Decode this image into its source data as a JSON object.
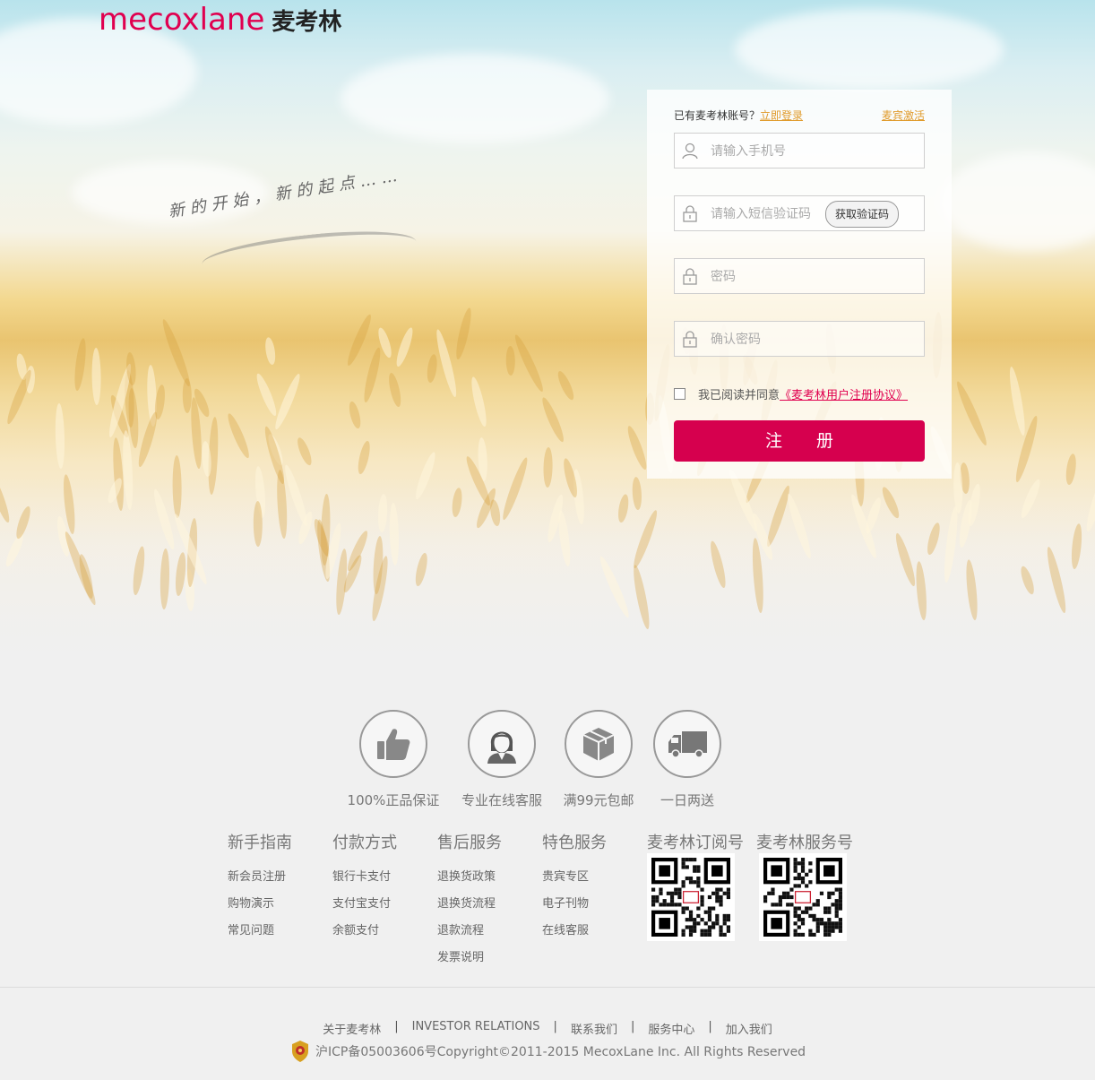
{
  "brand": {
    "logo_en": "mecoxlane",
    "logo_cn": "麦考林",
    "brand_color": "#e0004f"
  },
  "hero": {
    "slogan": "新的开始，新的起点……"
  },
  "register": {
    "has_account": "已有麦考林账号？",
    "login_link": "立即登录",
    "activate_link": "麦宾激活",
    "phone_placeholder": "请输入手机号",
    "sms_placeholder": "请输入短信验证码",
    "sms_button": "获取验证码",
    "password_placeholder": "密码",
    "confirm_placeholder": "确认密码",
    "agree_text": "我已阅读并同意",
    "agreement_link": "《麦考林用户注册协议》",
    "submit_label": "注册",
    "submit_color": "#d6004e"
  },
  "features": [
    {
      "icon": "thumbs-up-icon",
      "label": "100%正品保证"
    },
    {
      "icon": "customer-service-icon",
      "label": "专业在线客服"
    },
    {
      "icon": "package-icon",
      "label": "满99元包邮"
    },
    {
      "icon": "truck-icon",
      "label": "一日两送"
    }
  ],
  "columns": [
    {
      "title": "新手指南",
      "items": [
        "新会员注册",
        "购物演示",
        "常见问题"
      ]
    },
    {
      "title": "付款方式",
      "items": [
        "银行卡支付",
        "支付宝支付",
        "余额支付"
      ]
    },
    {
      "title": "售后服务",
      "items": [
        "退换货政策",
        "退换货流程",
        "退款流程",
        "发票说明"
      ]
    },
    {
      "title": "特色服务",
      "items": [
        "贵宾专区",
        "电子刊物",
        "在线客服"
      ]
    }
  ],
  "qr": [
    {
      "title": "麦考林订阅号",
      "icon": "qr-code-icon"
    },
    {
      "title": "麦考林服务号",
      "icon": "qr-code-icon"
    }
  ],
  "footer": {
    "links": [
      "关于麦考林",
      "INVESTOR RELATIONS",
      "联系我们",
      "服务中心",
      "加入我们"
    ],
    "separator": "|",
    "copyright": "沪ICP备05003606号Copyright©2011-2015 MecoxLane Inc. All Rights Reserved",
    "badge_icon": "police-badge-icon"
  }
}
